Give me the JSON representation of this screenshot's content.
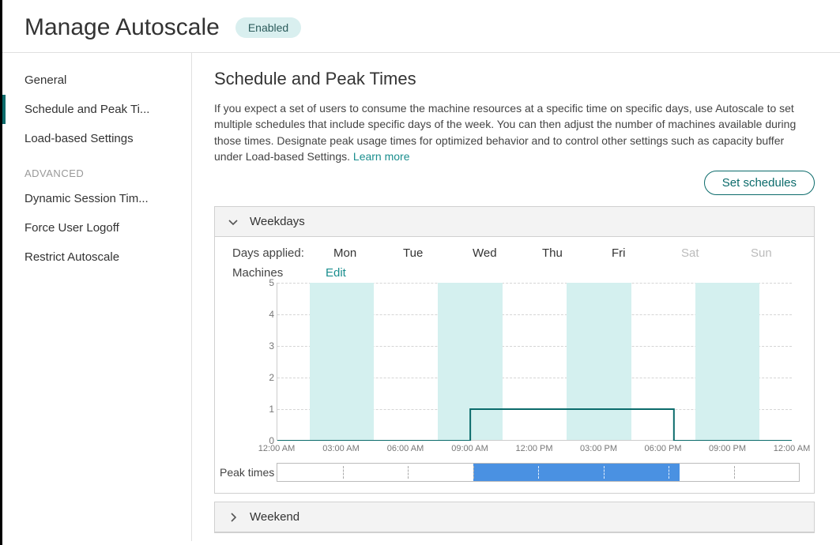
{
  "header": {
    "title": "Manage Autoscale",
    "status_badge": "Enabled"
  },
  "sidebar": {
    "items": [
      {
        "label": "General",
        "active": false
      },
      {
        "label": "Schedule and Peak Ti...",
        "active": true
      },
      {
        "label": "Load-based Settings",
        "active": false
      }
    ],
    "section_label": "ADVANCED",
    "adv_items": [
      {
        "label": "Dynamic Session Tim..."
      },
      {
        "label": "Force User Logoff"
      },
      {
        "label": "Restrict Autoscale"
      }
    ]
  },
  "main": {
    "title": "Schedule and Peak Times",
    "desc": "If you expect a set of users to consume the machine resources at a specific time on specific days, use Autoscale to set multiple schedules that include specific days of the week. You can then adjust the number of machines available during those times. Designate peak usage times for optimized behavior and to control other settings such as capacity buffer under Load-based Settings.",
    "learn_more": "Learn more",
    "set_schedules_btn": "Set schedules"
  },
  "panel_weekdays": {
    "header": "Weekdays",
    "days_applied_label": "Days applied:",
    "days": [
      {
        "label": "Mon",
        "active": true
      },
      {
        "label": "Tue",
        "active": true
      },
      {
        "label": "Wed",
        "active": true
      },
      {
        "label": "Thu",
        "active": true
      },
      {
        "label": "Fri",
        "active": true
      },
      {
        "label": "Sat",
        "active": false
      },
      {
        "label": "Sun",
        "active": false
      }
    ],
    "machines_label": "Machines",
    "edit_label": "Edit",
    "peak_label": "Peak times"
  },
  "panel_weekend": {
    "header": "Weekend"
  },
  "chart_data": {
    "type": "line",
    "title": "",
    "xlabel": "",
    "ylabel": "",
    "ylim": [
      0,
      5
    ],
    "y_ticks": [
      0,
      1,
      2,
      3,
      4,
      5
    ],
    "x_ticks_hours": [
      0,
      3,
      6,
      9,
      12,
      15,
      18,
      21,
      24
    ],
    "x_tick_labels": [
      "12:00 AM",
      "03:00 AM",
      "06:00 AM",
      "09:00 AM",
      "12:00 PM",
      "03:00 PM",
      "06:00 PM",
      "09:00 PM",
      "12:00 AM"
    ],
    "background_bands_hours": [
      [
        1.5,
        4.5
      ],
      [
        7.5,
        10.5
      ],
      [
        13.5,
        16.5
      ],
      [
        19.5,
        22.5
      ]
    ],
    "series": [
      {
        "name": "Machines",
        "points_hours": [
          [
            0,
            0
          ],
          [
            9,
            0
          ],
          [
            9,
            1
          ],
          [
            18.5,
            1
          ],
          [
            18.5,
            0
          ],
          [
            24,
            0
          ]
        ]
      }
    ],
    "peak_segments_hours": [
      [
        9,
        18.5
      ]
    ],
    "peak_ticks_hours": [
      3,
      6,
      9,
      12,
      15,
      18,
      21
    ]
  }
}
